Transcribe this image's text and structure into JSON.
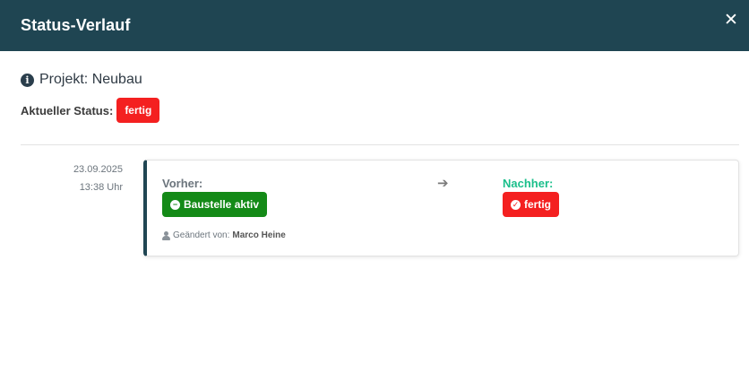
{
  "header": {
    "title": "Status-Verlauf",
    "close_symbol": "✕"
  },
  "project": {
    "icon": "info-icon",
    "text": "Projekt: Neubau"
  },
  "current_status": {
    "label": "Aktueller Status:",
    "value": "fertig",
    "color": "#f42020"
  },
  "history": [
    {
      "date": "23.09.2025",
      "time": "13:38 Uhr",
      "before_label": "Vorher:",
      "before_status": "Baustelle aktiv",
      "before_icon": "minus-circle-icon",
      "before_color": "#148a17",
      "arrow": "➔",
      "after_label": "Nachher:",
      "after_status": "fertig",
      "after_icon": "check-circle-icon",
      "after_color": "#f42020",
      "changed_by_label": "Geändert von:",
      "changed_by_name": "Marco Heine"
    }
  ],
  "colors": {
    "header_bg": "#1f4552",
    "accent_green_label": "#1bbf8b"
  }
}
